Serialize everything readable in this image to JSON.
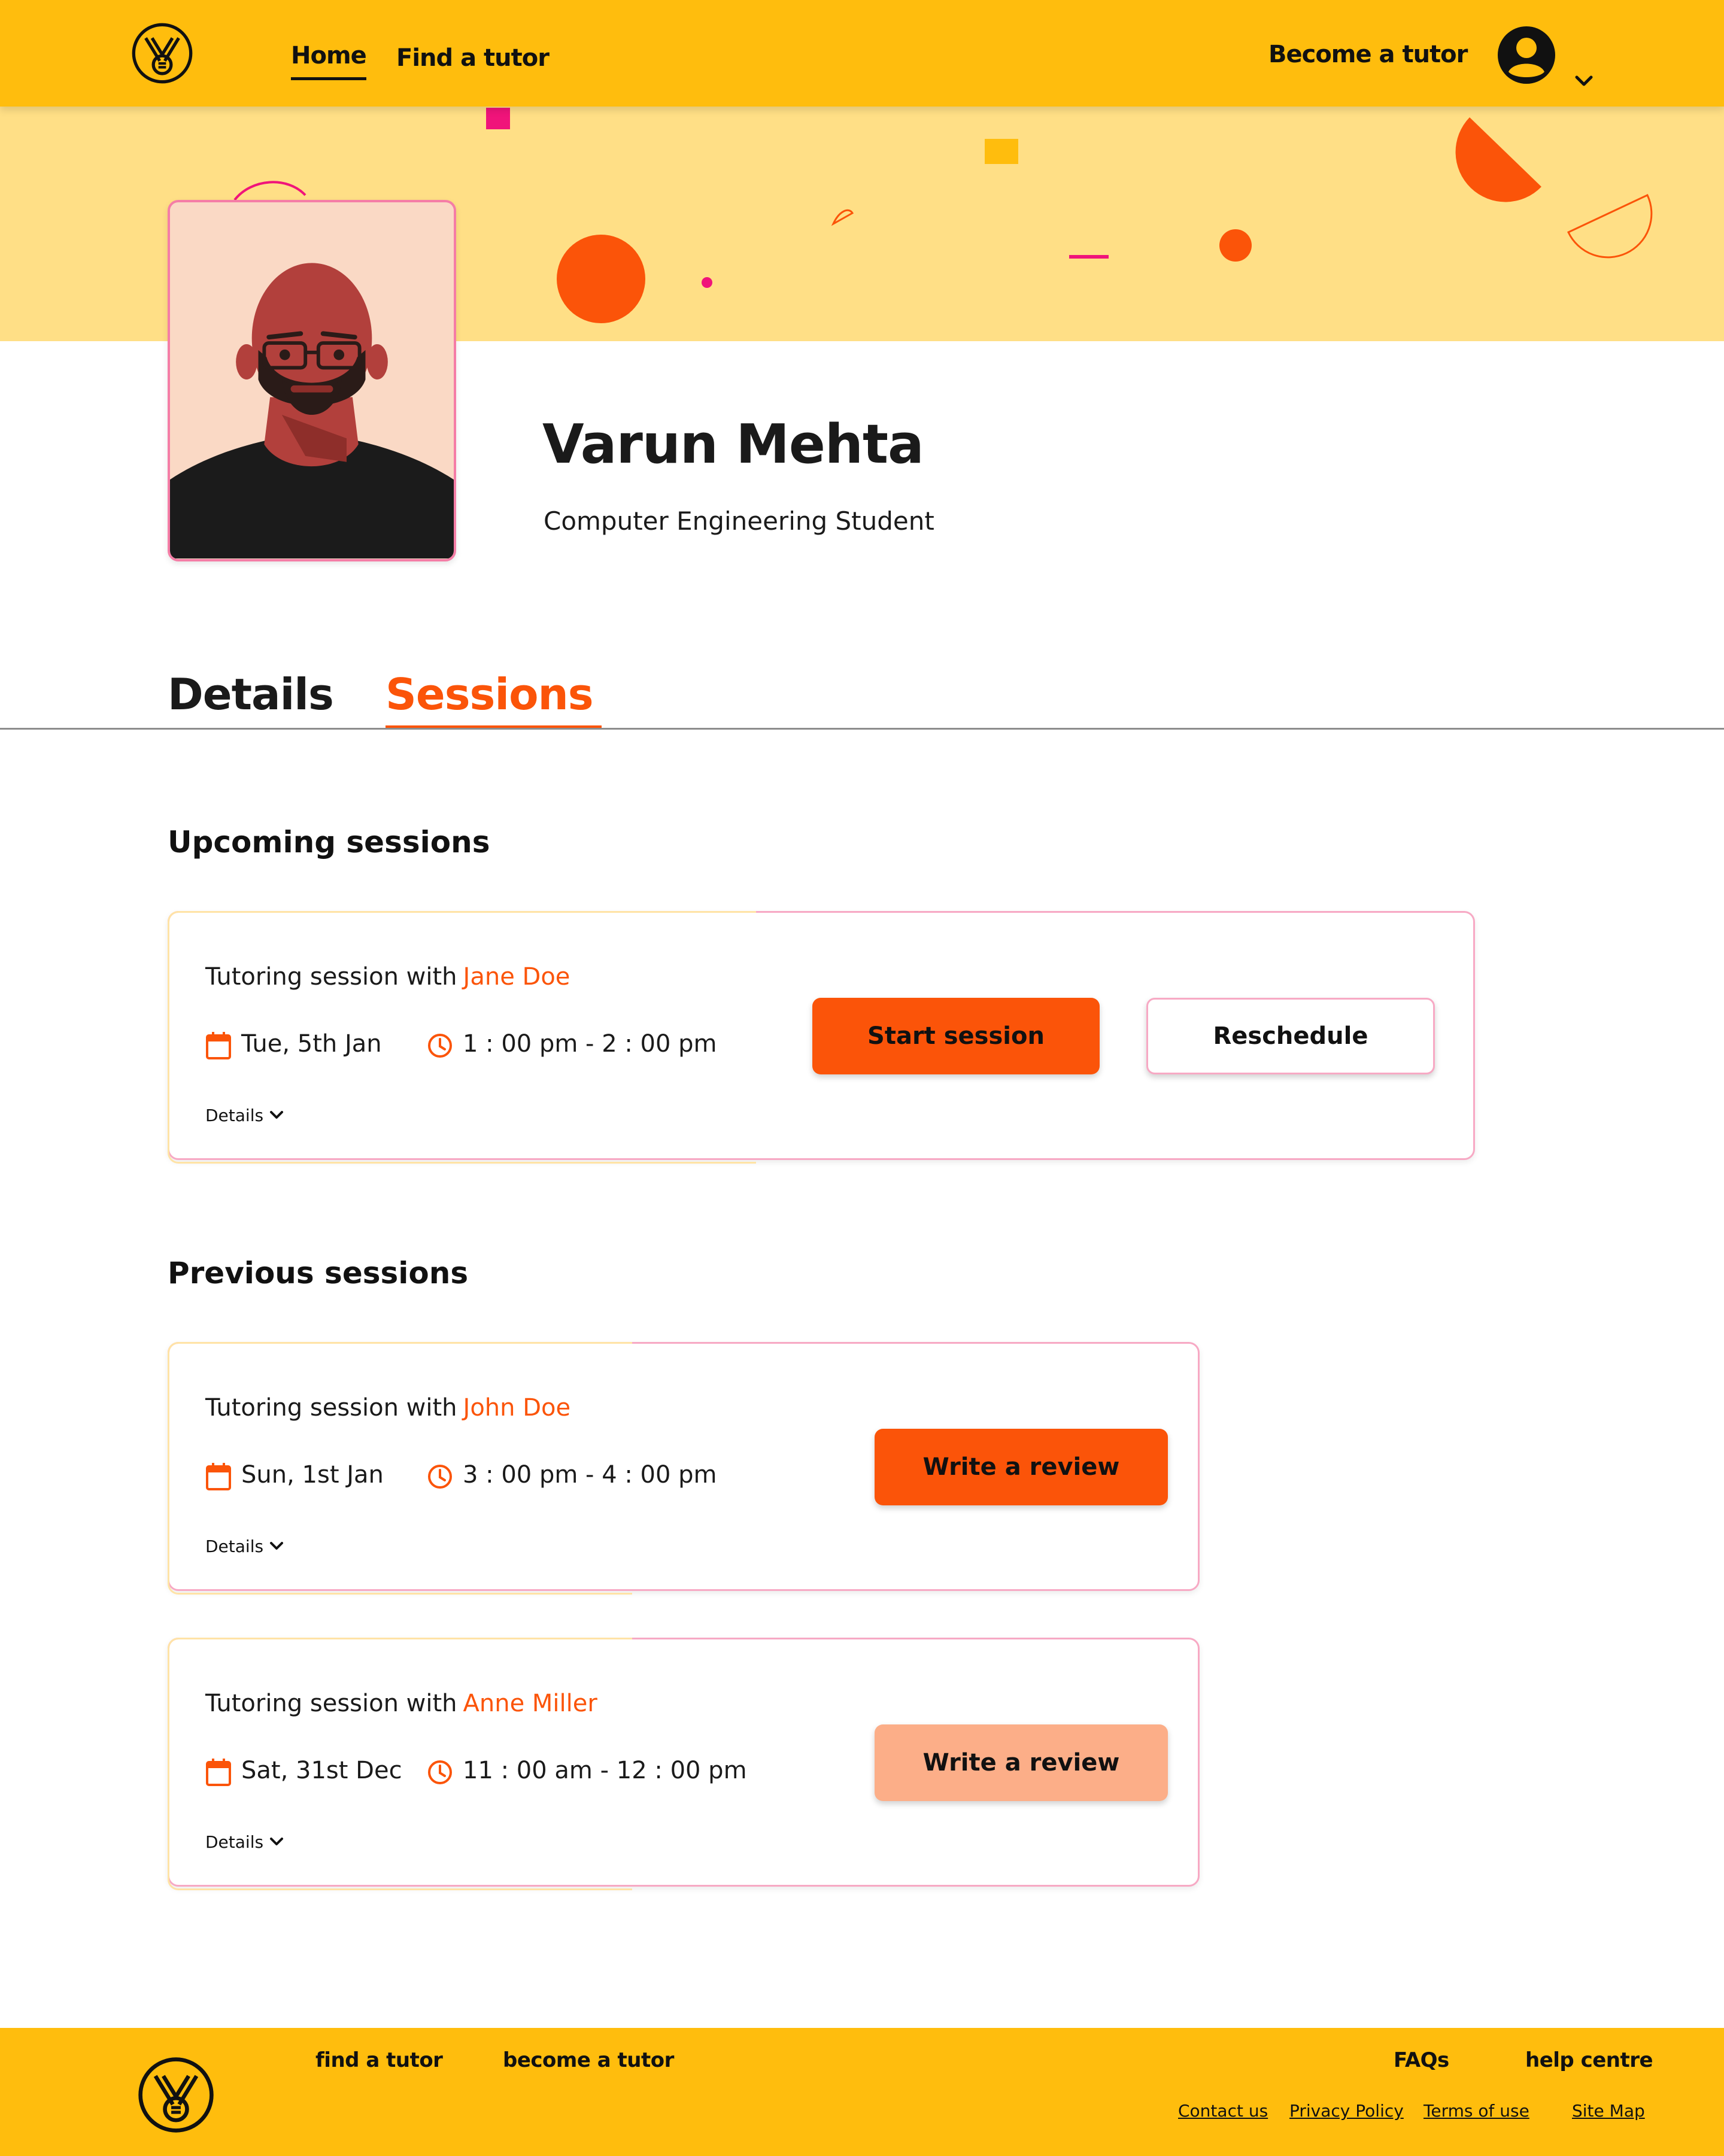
{
  "header": {
    "nav": {
      "home": "Home",
      "find_tutor": "Find a tutor"
    },
    "become_tutor": "Become a tutor",
    "icons": {
      "logo": "medal-logo",
      "account": "user-circle-icon",
      "menu": "chevron-down-icon"
    }
  },
  "profile": {
    "name": "Varun Mehta",
    "role": "Computer Engineering Student"
  },
  "tabs": {
    "details": "Details",
    "sessions": "Sessions",
    "active": "Sessions"
  },
  "upcoming": {
    "title": "Upcoming sessions",
    "sessions": [
      {
        "prefix": "Tutoring session with",
        "tutor": "Jane Doe",
        "date": "Tue, 5th Jan",
        "time": "1 : 00 pm - 2 : 00 pm",
        "details_label": "Details",
        "primary_action": "Start session",
        "secondary_action": "Reschedule"
      }
    ]
  },
  "previous": {
    "title": "Previous sessions",
    "sessions": [
      {
        "prefix": "Tutoring session with",
        "tutor": "John Doe",
        "date": "Sun, 1st Jan",
        "time": "3 : 00 pm - 4 : 00 pm",
        "details_label": "Details",
        "action": "Write a review"
      },
      {
        "prefix": "Tutoring session with",
        "tutor": "Anne Miller",
        "date": "Sat, 31st Dec",
        "time": "11 : 00 am - 12 : 00 pm",
        "details_label": "Details",
        "action": "Write a review"
      }
    ]
  },
  "footer": {
    "links": {
      "find_tutor": "find a tutor",
      "become_tutor": "become a tutor",
      "faqs": "FAQs",
      "help": "help centre"
    },
    "legal": {
      "contact": "Contact us",
      "privacy": "Privacy Policy",
      "terms": "Terms of use",
      "sitemap": "Site Map"
    }
  },
  "colors": {
    "brand_yellow": "#FFBD0D",
    "banner_yellow": "#FFDF86",
    "accent_orange": "#FB5409",
    "accent_orange_light": "#FCAE88",
    "accent_pink": "#F0147A",
    "text": "#111111"
  }
}
